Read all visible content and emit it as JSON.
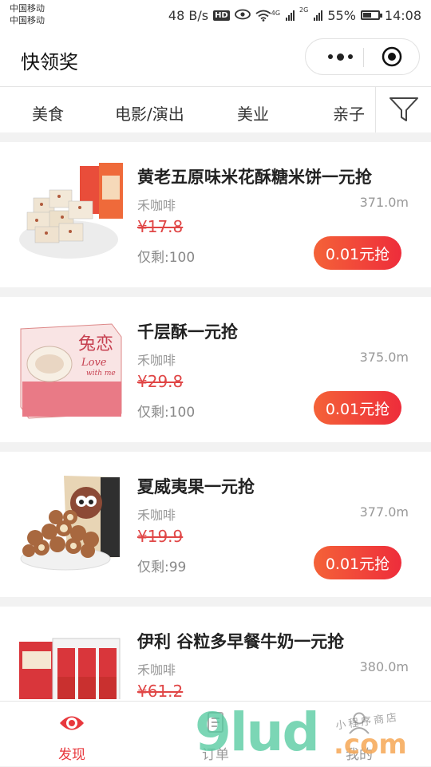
{
  "status_bar": {
    "carrier_1": "中国移动",
    "carrier_2": "中国移动",
    "net_speed": "48 B/s",
    "hd": "HD",
    "net_4g": "4G",
    "net_2g": "2G",
    "battery_text": "55%",
    "battery_level": 0.55,
    "time": "14:08"
  },
  "navbar": {
    "title": "快领奖"
  },
  "categories": [
    "美食",
    "电影/演出",
    "美业",
    "亲子"
  ],
  "products": [
    {
      "title": "黄老五原味米花酥糖米饼一元抢",
      "shop": "禾咖啡",
      "distance": "371.0m",
      "original_price": "¥17.8",
      "stock": "仅剩:100",
      "button": "0.01元抢"
    },
    {
      "title": "千层酥一元抢",
      "shop": "禾咖啡",
      "distance": "375.0m",
      "original_price": "¥29.8",
      "stock": "仅剩:100",
      "button": "0.01元抢",
      "image_text_1": "兔恋",
      "image_text_2": "Love",
      "image_text_3": "with me"
    },
    {
      "title": "夏威夷果一元抢",
      "shop": "禾咖啡",
      "distance": "377.0m",
      "original_price": "¥19.9",
      "stock": "仅剩:99",
      "button": "0.01元抢"
    },
    {
      "title": "伊利 谷粒多早餐牛奶一元抢",
      "shop": "禾咖啡",
      "distance": "380.0m",
      "original_price": "¥61.2"
    }
  ],
  "tabbar": {
    "items": [
      {
        "label": "发现",
        "active": true
      },
      {
        "label": "订单",
        "active": false
      },
      {
        "label": "我的",
        "active": false
      }
    ]
  },
  "watermark": {
    "brand": "9lud",
    "domain": ".com",
    "small": "小程序商店"
  },
  "colors": {
    "accent_red": "#e8383d",
    "button_gradient_start": "#f46238",
    "button_gradient_end": "#ee2d3b",
    "price_red": "#e04646"
  }
}
